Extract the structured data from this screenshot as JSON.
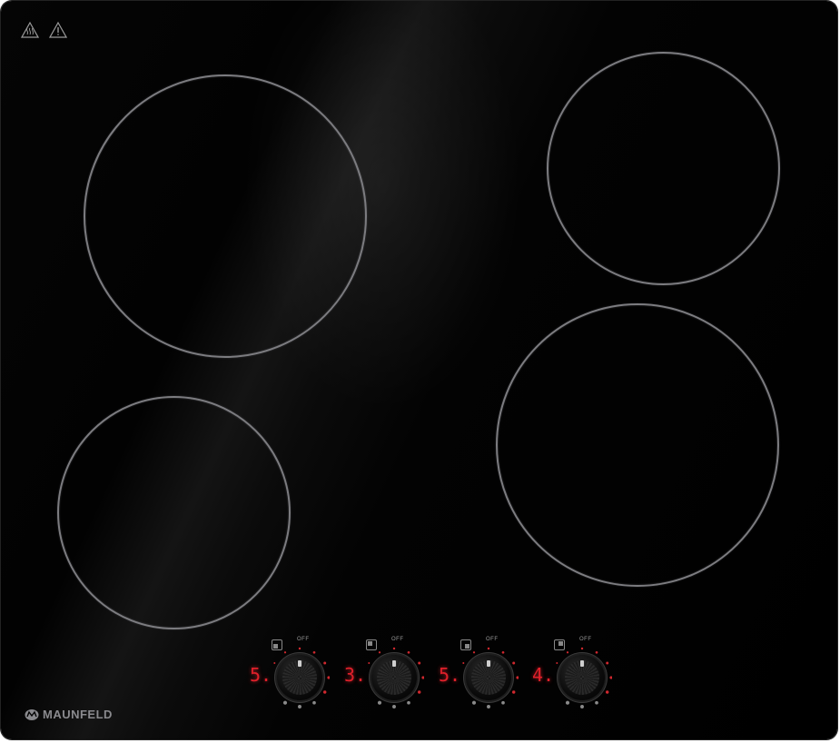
{
  "brand": {
    "name": "MAUNFELD",
    "logo_icon": "maunfeld-logo-icon"
  },
  "warnings": [
    {
      "icon": "hot-surface-warning-icon"
    },
    {
      "icon": "caution-triangle-icon"
    }
  ],
  "zones": [
    {
      "id": "rear-left",
      "label": ""
    },
    {
      "id": "front-left",
      "label": ""
    },
    {
      "id": "rear-right",
      "label": ""
    },
    {
      "id": "front-right",
      "label": ""
    }
  ],
  "controls": [
    {
      "id": "control-1",
      "display": "5.",
      "off_label": "OFF"
    },
    {
      "id": "control-2",
      "display": "3.",
      "off_label": "OFF"
    },
    {
      "id": "control-3",
      "display": "5.",
      "off_label": "OFF"
    },
    {
      "id": "control-4",
      "display": "4.",
      "off_label": "OFF"
    }
  ],
  "colors": {
    "glass": "#000000",
    "zone_ring": "#7c7c80",
    "led": "#e0202a",
    "brand_text": "#8a8a8e"
  }
}
